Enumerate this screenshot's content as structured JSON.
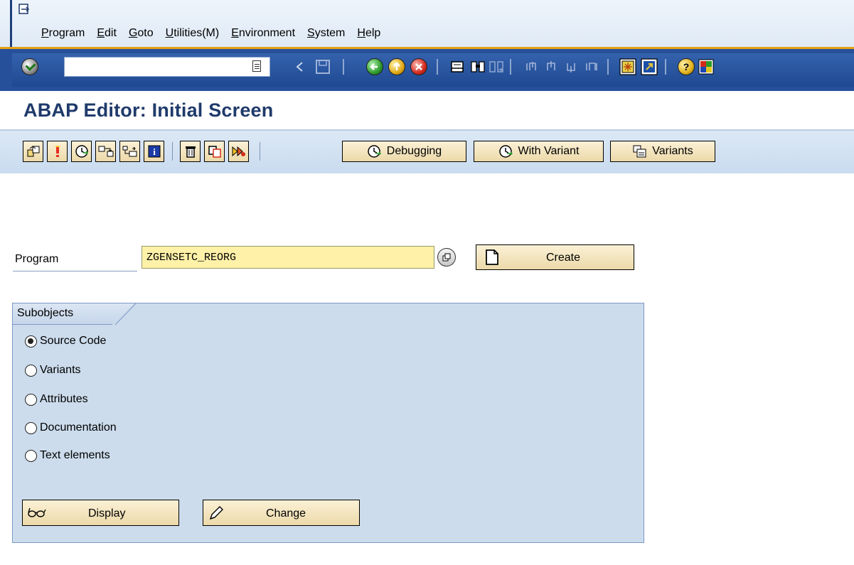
{
  "menu": {
    "items": [
      {
        "label": "Program"
      },
      {
        "label": "Edit"
      },
      {
        "label": "Goto"
      },
      {
        "label": "Utilities(M)"
      },
      {
        "label": "Environment"
      },
      {
        "label": "System"
      },
      {
        "label": "Help"
      }
    ]
  },
  "command_field": {
    "value": ""
  },
  "title": "ABAP Editor: Initial Screen",
  "app_toolbar": {
    "debugging_label": "Debugging",
    "with_variant_label": "With Variant",
    "variants_label": "Variants"
  },
  "program": {
    "label": "Program",
    "value": "ZGENSETC_REORG",
    "create_label": "Create"
  },
  "subobjects": {
    "title": "Subobjects",
    "options": [
      {
        "label": "Source Code",
        "selected": true
      },
      {
        "label": "Variants",
        "selected": false
      },
      {
        "label": "Attributes",
        "selected": false
      },
      {
        "label": "Documentation",
        "selected": false
      },
      {
        "label": "Text elements",
        "selected": false
      }
    ],
    "display_label": "Display",
    "change_label": "Change"
  },
  "colors": {
    "toolbar_bg": "#27509b",
    "accent_orange": "#e69f14",
    "title_blue": "#1f3a6b",
    "button_face": "#ecd9a9",
    "input_required": "#fff1a8",
    "group_bg": "#ccdcec"
  }
}
